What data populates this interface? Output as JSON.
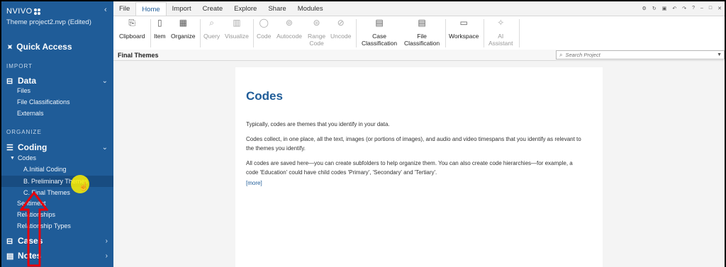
{
  "sidebar": {
    "app_name": "NVIVO",
    "project": "Theme project2.nvp (Edited)",
    "quick_access": "Quick Access",
    "import_label": "IMPORT",
    "data_group": "Data",
    "data_items": [
      "Files",
      "File Classifications",
      "Externals"
    ],
    "organize_label": "ORGANIZE",
    "coding_group": "Coding",
    "codes": "Codes",
    "code_children": [
      "A.Initial Coding",
      "B. Preliminary Themes",
      "C. Final Themes"
    ],
    "sentiment": "Sentiment",
    "relationships": "Relationships",
    "relationship_types": "Relationship Types",
    "cases_group": "Cases",
    "notes_group": "Notes"
  },
  "ribbon": {
    "tabs": [
      "File",
      "Home",
      "Import",
      "Create",
      "Explore",
      "Share",
      "Modules"
    ],
    "tools": {
      "clipboard": "Clipboard",
      "item": "Item",
      "organize": "Organize",
      "query": "Query",
      "visualize": "Visualize",
      "code": "Code",
      "autocode": "Autocode",
      "range_code_1": "Range",
      "range_code_2": "Code",
      "uncode": "Uncode",
      "case_class_1": "Case",
      "case_class_2": "Classification",
      "file_class_1": "File",
      "file_class_2": "Classification",
      "workspace": "Workspace",
      "ai_1": "AI",
      "ai_2": "Assistant"
    }
  },
  "breadcrumb": {
    "title": "Final Themes"
  },
  "search": {
    "placeholder": "Search Project"
  },
  "content": {
    "heading": "Codes",
    "p1": "Typically, codes are themes that you identify in your data.",
    "p2": "Codes collect, in one place, all the text, images (or portions of images), and audio and video timespans that you identify as relevant to the themes you identify.",
    "p3": "All codes are saved here—you can create subfolders to help organize them. You can also create code hierarchies—for example, a code 'Education' could have child codes 'Primary', 'Secondary' and 'Tertiary'.",
    "more": "[more]"
  },
  "colors": {
    "sidebar": "#1f5c98",
    "accent": "#1f5c98",
    "highlight": "#fff100",
    "annotation_arrow": "#e8000b"
  }
}
